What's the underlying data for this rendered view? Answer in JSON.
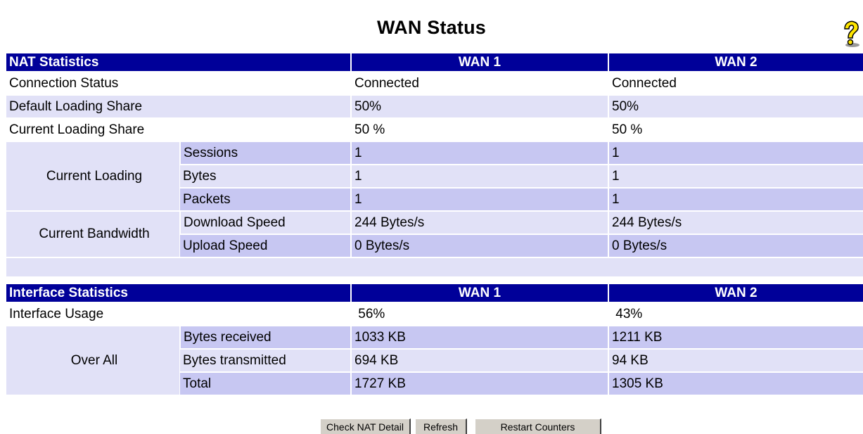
{
  "page": {
    "title": "WAN Status"
  },
  "icons": {
    "help": "help-question-icon"
  },
  "colors": {
    "header_bg": "#000099",
    "row_light": "#e1e1f7",
    "row_medium": "#c7c7f2",
    "button_face": "#d4d0c8"
  },
  "nat": {
    "header": [
      "NAT Statistics",
      "WAN 1",
      "WAN 2"
    ],
    "connection_status": {
      "label": "Connection Status",
      "wan1": "Connected",
      "wan2": "Connected"
    },
    "default_loading_share": {
      "label": "Default Loading Share",
      "wan1": "50%",
      "wan2": "50%"
    },
    "current_loading_share": {
      "label": "Current Loading Share",
      "wan1": "50 %",
      "wan2": "50 %"
    },
    "current_loading": {
      "label": "Current Loading",
      "sessions": {
        "label": "Sessions",
        "wan1": "1",
        "wan2": "1"
      },
      "bytes": {
        "label": "Bytes",
        "wan1": "1",
        "wan2": "1"
      },
      "packets": {
        "label": "Packets",
        "wan1": "1",
        "wan2": "1"
      }
    },
    "current_bandwidth": {
      "label": "Current Bandwidth",
      "download": {
        "label": "Download Speed",
        "wan1": "244 Bytes/s",
        "wan2": "244 Bytes/s"
      },
      "upload": {
        "label": "Upload Speed",
        "wan1": "0 Bytes/s",
        "wan2": "0 Bytes/s"
      }
    }
  },
  "iface": {
    "header": [
      "Interface Statistics",
      "WAN 1",
      "WAN 2"
    ],
    "usage": {
      "label": "Interface Usage",
      "wan1": " 56%",
      "wan2": " 43%"
    },
    "over_all": {
      "label": "Over All",
      "received": {
        "label": "Bytes received",
        "wan1": "1033 KB",
        "wan2": "1211 KB"
      },
      "transmitted": {
        "label": "Bytes transmitted",
        "wan1": "694 KB",
        "wan2": "94 KB"
      },
      "total": {
        "label": "Total",
        "wan1": "1727 KB",
        "wan2": "1305 KB"
      }
    }
  },
  "buttons": {
    "check_nat": "Check NAT Detail",
    "refresh": "Refresh",
    "restart": "Restart Counters"
  }
}
